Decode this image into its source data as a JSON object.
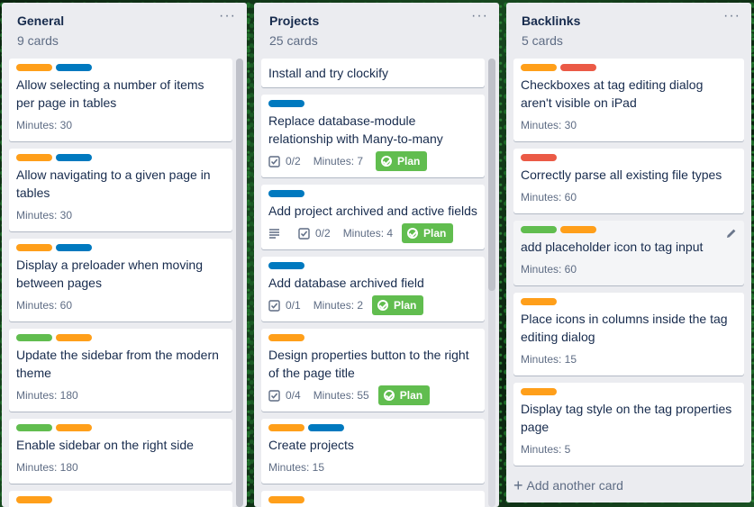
{
  "lists": [
    {
      "title": "General",
      "count": "9 cards",
      "menu": "···",
      "cards": [
        {
          "labels": [
            "#ff9f1a",
            "#0079bf"
          ],
          "title": "Allow selecting a number of items per page in tables",
          "minutes": "Minutes: 30"
        },
        {
          "labels": [
            "#ff9f1a",
            "#0079bf"
          ],
          "title": "Allow navigating to a given page in tables",
          "minutes": "Minutes: 30"
        },
        {
          "labels": [
            "#ff9f1a",
            "#0079bf"
          ],
          "title": "Display a preloader when moving between pages",
          "minutes": "Minutes: 60"
        },
        {
          "labels": [
            "#61bd4f",
            "#ff9f1a"
          ],
          "title": "Update the sidebar from the modern theme",
          "minutes": "Minutes: 180"
        },
        {
          "labels": [
            "#61bd4f",
            "#ff9f1a"
          ],
          "title": "Enable sidebar on the right side",
          "minutes": "Minutes: 180"
        },
        {
          "labels": [
            "#ff9f1a"
          ],
          "title": "",
          "minutes": ""
        }
      ]
    },
    {
      "title": "Projects",
      "count": "25 cards",
      "menu": "···",
      "cards": [
        {
          "labels": [],
          "title": "Install and try clockify"
        },
        {
          "labels": [
            "#0079bf"
          ],
          "title": "Replace database-module relationship with Many-to-many",
          "checklist": "0/2",
          "minutes": "Minutes: 7",
          "plan": "Plan"
        },
        {
          "labels": [
            "#0079bf"
          ],
          "title": "Add project archived and active fields",
          "description": true,
          "checklist": "0/2",
          "minutes": "Minutes: 4",
          "plan": "Plan"
        },
        {
          "labels": [
            "#0079bf"
          ],
          "title": "Add database archived field",
          "checklist": "0/1",
          "minutes": "Minutes: 2",
          "plan": "Plan"
        },
        {
          "labels": [
            "#ff9f1a"
          ],
          "title": "Design properties button to the right of the page title",
          "checklist": "0/4",
          "minutes": "Minutes: 55",
          "plan": "Plan"
        },
        {
          "labels": [
            "#ff9f1a",
            "#0079bf"
          ],
          "title": "Create projects",
          "minutes": "Minutes: 15"
        },
        {
          "labels": [
            "#ff9f1a"
          ],
          "title": ""
        }
      ]
    },
    {
      "title": "Backlinks",
      "count": "5 cards",
      "menu": "···",
      "cards": [
        {
          "labels": [
            "#ff9f1a",
            "#eb5a46"
          ],
          "title": "Checkboxes at tag editing dialog aren't visible on iPad",
          "minutes": "Minutes: 30"
        },
        {
          "labels": [
            "#eb5a46"
          ],
          "title": "Correctly parse all existing file types",
          "minutes": "Minutes: 60"
        },
        {
          "labels": [
            "#61bd4f",
            "#ff9f1a"
          ],
          "title": "add placeholder icon to tag input",
          "minutes": "Minutes: 60"
        },
        {
          "labels": [
            "#ff9f1a"
          ],
          "title": "Place icons in columns inside the tag editing dialog",
          "minutes": "Minutes: 15"
        },
        {
          "labels": [
            "#ff9f1a"
          ],
          "title": "Display tag style on the tag properties page",
          "minutes": "Minutes: 5"
        }
      ],
      "add_card": "Add another card"
    }
  ]
}
